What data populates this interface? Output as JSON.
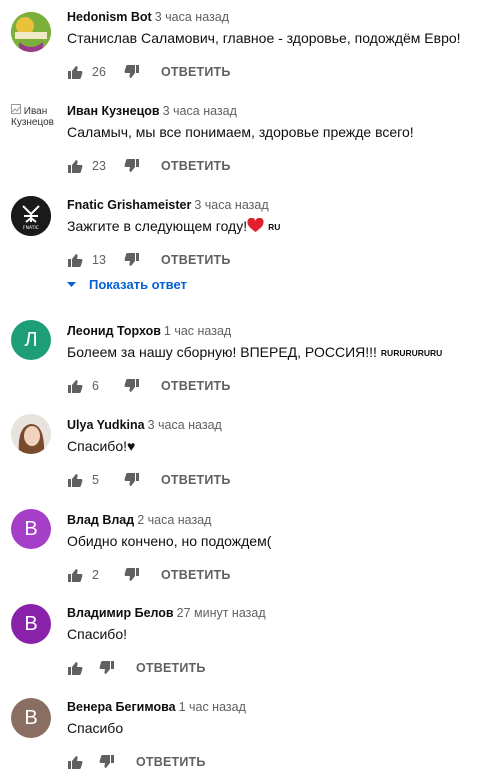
{
  "reply_label": "ОТВЕТИТЬ",
  "show_replies_label": "Показать ответ",
  "comments": [
    {
      "author": "Hedonism Bot",
      "time": "3 часа назад",
      "text": "Станислав Саламович, главное - здоровье, подождём Евро!",
      "likes": "26"
    },
    {
      "author": "Иван Кузнецов",
      "time": "3 часа назад",
      "text": "Саламыч, мы все понимаем, здоровье прежде всего!",
      "likes": "23",
      "avatar_alt": "Иван Кузнецов"
    },
    {
      "author": "Fnatic Grishameister",
      "time": "3 часа назад",
      "text": "Зажгите в следующем году!",
      "flag": "RU",
      "likes": "13"
    },
    {
      "author": "Леонид Торхов",
      "time": "1 час назад",
      "text": "Болеем за нашу сборную! ВПЕРЕД, РОССИЯ!!!",
      "flag": "RURURURURU",
      "likes": "6",
      "avatar_letter": "Л",
      "avatar_color": "#1e9e76"
    },
    {
      "author": "Ulya Yudkina",
      "time": "3 часа назад",
      "text": "Спасибо!♥",
      "likes": "5"
    },
    {
      "author": "Влад Влад",
      "time": "2 часа назад",
      "text": "Обидно кончено, но подождем(",
      "likes": "2",
      "avatar_letter": "B",
      "avatar_color": "#a53fc7"
    },
    {
      "author": "Владимир Белов",
      "time": "27 минут назад",
      "text": "Спасибо!",
      "likes": "",
      "avatar_letter": "B",
      "avatar_color": "#8a22a9"
    },
    {
      "author": "Венера Бегимова",
      "time": "1 час назад",
      "text": "Спасибо",
      "likes": "",
      "avatar_letter": "B",
      "avatar_color": "#8b6e62"
    }
  ]
}
